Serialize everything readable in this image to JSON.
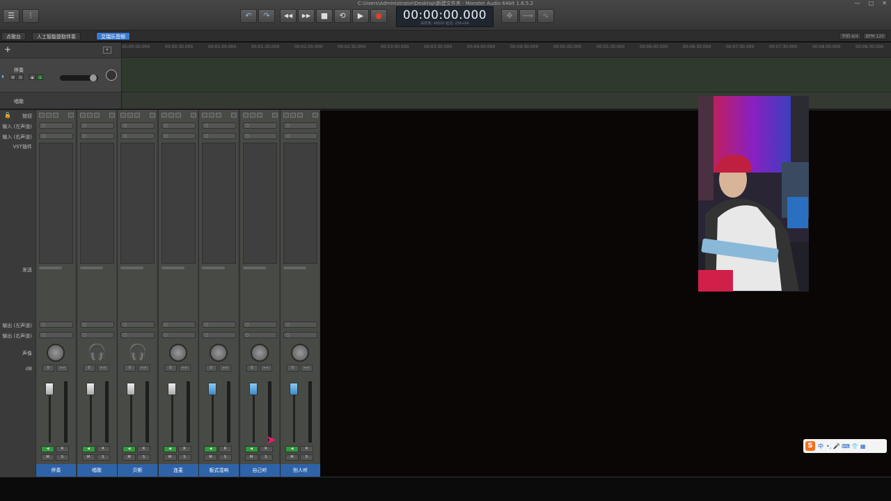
{
  "window": {
    "title": "C:\\Users\\Administrator\\Desktop\\新建文件夹 - Monster Audio 64bit 1.6.5.2",
    "controls": [
      "—",
      "□",
      "✕"
    ]
  },
  "toolbar": {
    "menu_icon": "☰",
    "mixer_icon": "⫶",
    "undo_icon": "↶",
    "redo_icon": "↷",
    "rewind_icon": "◀◀",
    "forward_icon": "▶▶",
    "stop_icon": "■",
    "loop_icon": "⟲",
    "play_icon": "▶",
    "record_icon": "●",
    "time": "00:00:00.000",
    "time_sub": "采样率: 48000    延迟: 256+64",
    "tool1_icon": "✥",
    "tool2_icon": "⟿",
    "tool3_icon": "∿"
  },
  "tabs": [
    {
      "label": "点歌台",
      "active": false
    },
    {
      "label": "人工智能提取伴奏",
      "active": false
    },
    {
      "label": "艾瑞乐音频",
      "active": true
    }
  ],
  "tabbar_right": {
    "signature": "节拍 4/4",
    "bpm": "BPM 120"
  },
  "tracks_header": {
    "add": "+",
    "menu": "▾"
  },
  "track1": {
    "name": "伴奏",
    "buttons": [
      "M",
      "S",
      "●",
      "◂"
    ]
  },
  "track2": {
    "name": "唱歌"
  },
  "ruler": [
    "00:00:00.000",
    "00:00:30.000",
    "00:01:00.000",
    "00:01:30.000",
    "00:02:00.000",
    "00:02:30.000",
    "00:03:00.000",
    "00:03:30.000",
    "00:04:00.000",
    "00:04:30.000",
    "00:05:00.000",
    "00:05:30.000",
    "00:06:00.000",
    "00:06:30.000",
    "00:07:00.000",
    "00:07:30.000",
    "00:08:00.000",
    "00:08:30.000"
  ],
  "mixer": {
    "lock_icon": "🔓",
    "labels": {
      "buttons": "按钮",
      "input_l": "输入 (左声道)",
      "input_r": "输入 (右声道)",
      "vst": "VST插件",
      "send": "发送",
      "output_l": "输出 (左声道)",
      "output_r": "输出 (右声道)",
      "pan": "声像",
      "db": "dB"
    },
    "io_symbol": "○",
    "db_value": "0",
    "db_arrow": "⟷",
    "btn_mon": "◀",
    "btn_r": "R",
    "btn_m": "M",
    "btn_s": "S",
    "headphone_icon": "🎧",
    "channels": [
      {
        "name": "伴奏",
        "monitor": "knob",
        "fader": "white"
      },
      {
        "name": "唱歌",
        "monitor": "headphone",
        "fader": "white"
      },
      {
        "name": "贝斯",
        "monitor": "headphone",
        "fader": "white"
      },
      {
        "name": "连麦",
        "monitor": "knob",
        "fader": "white"
      },
      {
        "name": "板式混响",
        "monitor": "knob",
        "fader": "blue"
      },
      {
        "name": "自己听",
        "monitor": "knob",
        "fader": "blue"
      },
      {
        "name": "别人听",
        "monitor": "knob",
        "fader": "blue"
      }
    ]
  },
  "ime": {
    "logo": "S",
    "lang": "中",
    "icons": "•, 🎤 ⌨ 👕 ▦"
  },
  "colors": {
    "accent": "#3c7ad0",
    "record": "#e0402a",
    "green": "#2e9a3a",
    "channel_name_bg": "#2e63a8"
  }
}
